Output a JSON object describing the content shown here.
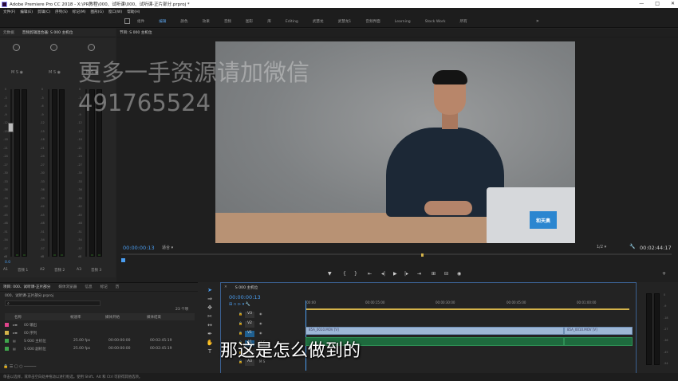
{
  "app": {
    "title": "Adobe Premiere Pro CC 2018 - X:\\PR教程\\000、试听课\\000、试听课-正片部分.prproj *"
  },
  "menu": [
    "文件(F)",
    "编辑(E)",
    "剪辑(C)",
    "序列(S)",
    "标记(M)",
    "图形(G)",
    "窗口(W)",
    "帮助(H)"
  ],
  "workspace_tabs": [
    {
      "label": "组件",
      "active": false
    },
    {
      "label": "编辑",
      "active": true
    },
    {
      "label": "颜色",
      "active": false
    },
    {
      "label": "效果",
      "active": false
    },
    {
      "label": "音频",
      "active": false
    },
    {
      "label": "图形",
      "active": false
    },
    {
      "label": "库",
      "active": false
    },
    {
      "label": "Editing",
      "active": false
    },
    {
      "label": "武慧龙",
      "active": false
    },
    {
      "label": "武慧龙1",
      "active": false
    },
    {
      "label": "音频界面",
      "active": false
    },
    {
      "label": "Learning",
      "active": false
    },
    {
      "label": "Stock Work",
      "active": false
    },
    {
      "label": "所有",
      "active": false
    }
  ],
  "mixer": {
    "tabs": [
      "元数据",
      "音频剪辑混合器: S 000 主机位"
    ],
    "channels": [
      "A1",
      "音频 1",
      "A2",
      "音频 2",
      "A3",
      "音频 3"
    ],
    "scale": [
      "0",
      "-3",
      "-6",
      "-9",
      "-12",
      "-15",
      "-18",
      "-21",
      "-24",
      "-27",
      "-30",
      "-33",
      "-36",
      "-39",
      "-42",
      "-45",
      "-48",
      "-51",
      "-54",
      "-57",
      "dB"
    ],
    "bottom_value": "0.0"
  },
  "program": {
    "tab": "节目: S 000 主机位",
    "timecode": "00:00:00:13",
    "fit": "适合",
    "resolution": "1/2",
    "duration": "00:02:44:17"
  },
  "watermark": {
    "line1": "更多一手资源请加微信",
    "line2": "491765524"
  },
  "video": {
    "laptop_logo": "和天奥"
  },
  "project": {
    "tabs": [
      "项目: 000、试听课-正片部分",
      "媒体浏览器",
      "信息",
      "标记",
      "历"
    ],
    "file": "000、试听课-正片部分.prproj",
    "count": "23 个项",
    "columns": [
      "名称",
      "帧速率",
      "媒体开始",
      "媒体结束"
    ],
    "rows": [
      {
        "name": "00 输出",
        "fps": "",
        "start": "",
        "end": ""
      },
      {
        "name": "00 序列",
        "fps": "",
        "start": "",
        "end": ""
      },
      {
        "name": "S 000 主机位",
        "fps": "25.00 fps",
        "start": "00:00:00:00",
        "end": "00:02:45:19"
      },
      {
        "name": "S 000 副机位",
        "fps": "25.00 fps",
        "start": "00:00:00:00",
        "end": "00:02:45:19"
      }
    ]
  },
  "timeline": {
    "tab": "S 000 主机位",
    "timecode": "00:00:00:13",
    "ruler": [
      ":00:00",
      "00:00:15:00",
      "00:00:30:00",
      "00:00:45:00",
      "00:01:00:00"
    ],
    "tracks": [
      "V3",
      "V2",
      "V1",
      "A1",
      "A2",
      "A3"
    ],
    "clips": [
      "85A_0010.MOV [V]",
      "85A_0010.MOV [V]"
    ]
  },
  "subtitle": "那这是怎么做到的",
  "status": "单击以选择，或单击空白处并拖动以进行框选。使用 Shift、Alt 和 Ctrl 可获得其他选项。"
}
